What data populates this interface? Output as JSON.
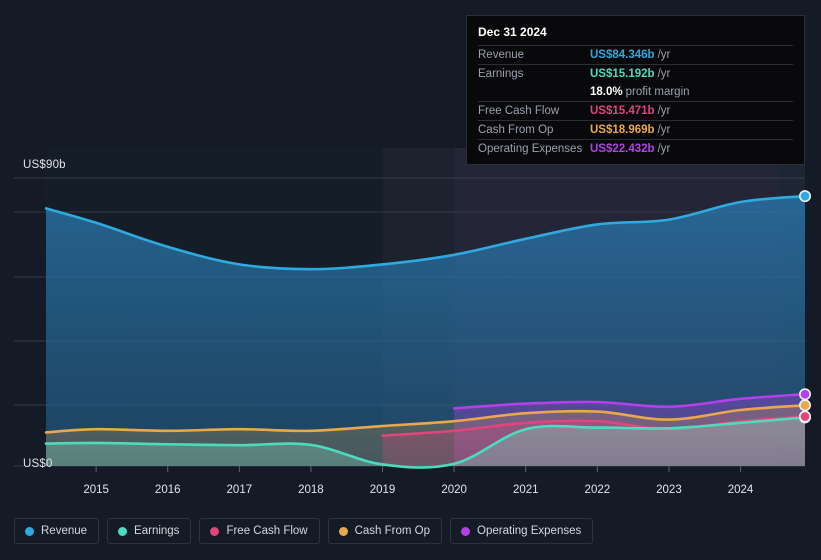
{
  "chart_data": {
    "type": "area",
    "title": "",
    "xlabel": "",
    "ylabel": "",
    "grid": true,
    "legend_position": "bottom",
    "currency": "US$",
    "units": "b",
    "ylim": [
      0,
      90
    ],
    "y_ticks": [
      0,
      90
    ],
    "y_tick_labels": [
      "US$0",
      "US$90b"
    ],
    "x": [
      2014.3,
      2015,
      2016,
      2017,
      2018,
      2019,
      2020,
      2021,
      2022,
      2023,
      2024,
      2024.9
    ],
    "x_ticks": [
      2015,
      2016,
      2017,
      2018,
      2019,
      2020,
      2021,
      2022,
      2023,
      2024
    ],
    "x_tick_labels": [
      "2015",
      "2016",
      "2017",
      "2018",
      "2019",
      "2020",
      "2021",
      "2022",
      "2023",
      "2024"
    ],
    "series": [
      {
        "name": "Revenue",
        "color": "#2eaae0",
        "values": [
          80.5,
          76.0,
          68.5,
          63.0,
          61.5,
          63.0,
          66.0,
          71.0,
          75.5,
          77.0,
          82.5,
          84.346
        ]
      },
      {
        "name": "Earnings",
        "color": "#4ddbc0",
        "values": [
          7.0,
          7.2,
          6.8,
          6.5,
          6.6,
          0.5,
          0.7,
          11.5,
          12.0,
          11.8,
          13.5,
          15.192
        ]
      },
      {
        "name": "Free Cash Flow",
        "color": "#e0457b",
        "values": [
          null,
          null,
          null,
          null,
          null,
          9.5,
          11.0,
          13.5,
          14.0,
          11.5,
          14.0,
          15.471
        ]
      },
      {
        "name": "Cash From Op",
        "color": "#eaa84a",
        "values": [
          10.5,
          11.5,
          11.0,
          11.5,
          11.0,
          12.5,
          14.0,
          16.5,
          17.0,
          14.5,
          17.5,
          18.969
        ]
      },
      {
        "name": "Operating Expenses",
        "color": "#b340e8",
        "values": [
          null,
          null,
          null,
          null,
          null,
          null,
          18.0,
          19.5,
          20.0,
          18.5,
          21.0,
          22.432
        ]
      }
    ]
  },
  "tooltip": {
    "date": "Dec 31 2024",
    "rows": [
      {
        "label": "Revenue",
        "value": "US$84.346b",
        "suffix": "/yr",
        "color": "#2eaae0"
      },
      {
        "label": "Earnings",
        "value": "US$15.192b",
        "suffix": "/yr",
        "color": "#4ddbc0"
      },
      {
        "label": "",
        "value": "18.0%",
        "suffix": "profit margin",
        "color": "#ffffff"
      },
      {
        "label": "Free Cash Flow",
        "value": "US$15.471b",
        "suffix": "/yr",
        "color": "#e0457b"
      },
      {
        "label": "Cash From Op",
        "value": "US$18.969b",
        "suffix": "/yr",
        "color": "#eaa84a"
      },
      {
        "label": "Operating Expenses",
        "value": "US$22.432b",
        "suffix": "/yr",
        "color": "#b340e8"
      }
    ]
  },
  "legend": {
    "items": [
      {
        "label": "Revenue",
        "color": "#2eaae0"
      },
      {
        "label": "Earnings",
        "color": "#4ddbc0"
      },
      {
        "label": "Free Cash Flow",
        "color": "#e0457b"
      },
      {
        "label": "Cash From Op",
        "color": "#eaa84a"
      },
      {
        "label": "Operating Expenses",
        "color": "#b340e8"
      }
    ]
  },
  "axis": {
    "y_top": "US$90b",
    "y_zero": "US$0"
  }
}
